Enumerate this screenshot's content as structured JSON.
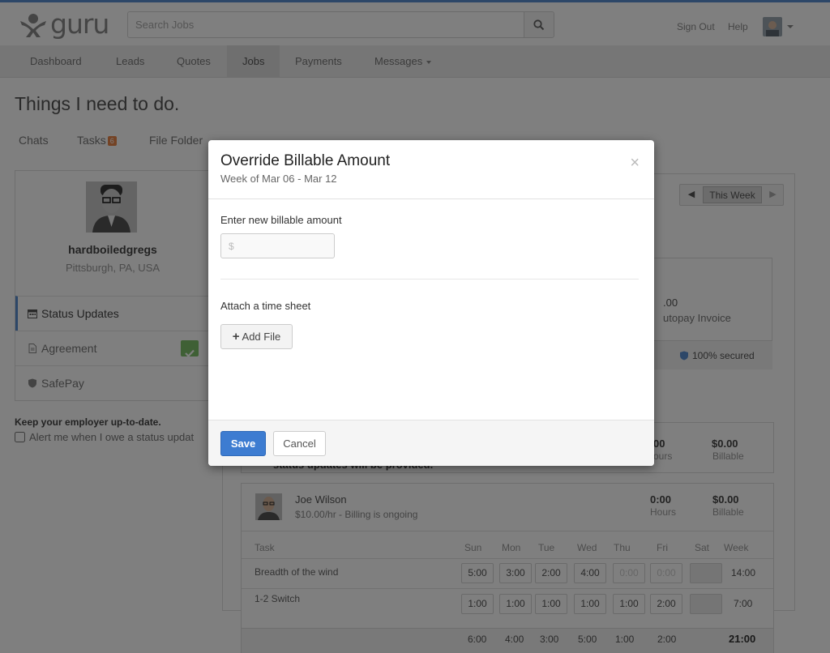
{
  "colors": {
    "accent": "#5a8fd0",
    "primary_button": "#3d7cd1",
    "badge": "#e8864a",
    "success": "#7fc16a"
  },
  "header": {
    "logo_text": "guru",
    "search": {
      "placeholder": "Search Jobs",
      "icon": "search-icon"
    },
    "sign_out": "Sign Out",
    "help": "Help"
  },
  "nav": {
    "items": [
      {
        "label": "Dashboard"
      },
      {
        "label": "Leads"
      },
      {
        "label": "Quotes"
      },
      {
        "label": "Jobs"
      },
      {
        "label": "Payments"
      },
      {
        "label": "Messages"
      }
    ],
    "active": "Jobs"
  },
  "page": {
    "title": "Things I need to do.",
    "tabs": [
      {
        "label": "Chats"
      },
      {
        "label": "Tasks",
        "badge": "6"
      },
      {
        "label": "File Folder"
      }
    ]
  },
  "profile": {
    "name": "hardboiledgregs",
    "location": "Pittsburgh, PA, USA",
    "menu": [
      {
        "label": "Status Updates",
        "icon": "calendar-icon"
      },
      {
        "label": "Agreement",
        "icon": "document-icon"
      },
      {
        "label": "SafePay",
        "icon": "shield-icon"
      }
    ],
    "keep_text": "Keep your employer up-to-date.",
    "alert_label": "Alert me when I owe a status updat"
  },
  "week_nav": {
    "label": "This Week"
  },
  "invoice": {
    "amount": ".00",
    "label": "utopay Invoice",
    "secured": "100% secured"
  },
  "summary_row": {
    "hours": "00",
    "hours_label": "ours",
    "billable": "$0.00",
    "billable_label": "Billable",
    "note": "status updates will be provided."
  },
  "employee": {
    "name": "Joe Wilson",
    "rate": "$10.00/hr  - Billing is ongoing",
    "hours": "0:00",
    "hours_label": "Hours",
    "billable": "$0.00",
    "billable_label": "Billable"
  },
  "timesheet": {
    "headers": [
      "Task",
      "Sun",
      "Mon",
      "Tue",
      "Wed",
      "Thu",
      "Fri",
      "Sat",
      "Week"
    ],
    "rows": [
      {
        "task": "Breadth of the wind",
        "cells": [
          "5:00",
          "3:00",
          "2:00",
          "4:00",
          "0:00",
          "0:00",
          ""
        ],
        "week": "14:00"
      },
      {
        "task": "1-2 Switch",
        "cells": [
          "1:00",
          "1:00",
          "1:00",
          "1:00",
          "1:00",
          "2:00",
          ""
        ],
        "week": "7:00"
      }
    ],
    "totals": [
      "6:00",
      "4:00",
      "3:00",
      "5:00",
      "1:00",
      "2:00"
    ],
    "grand_total": "21:00"
  },
  "modal": {
    "title": "Override Billable Amount",
    "subtitle": "Week of Mar 06 - Mar 12",
    "amount_label": "Enter new billable amount",
    "amount_placeholder": "$",
    "amount_value": "",
    "attach_label": "Attach a time sheet",
    "add_file_label": "Add File",
    "save_label": "Save",
    "cancel_label": "Cancel",
    "close_glyph": "×"
  }
}
